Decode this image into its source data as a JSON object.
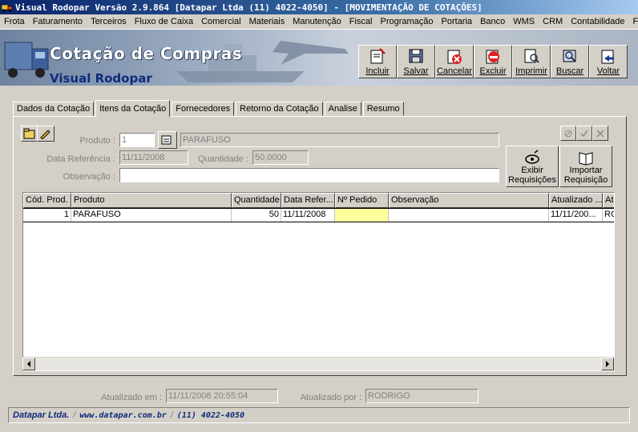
{
  "window": {
    "title": "Visual Rodopar Versão 2.9.864 [Datapar Ltda (11) 4022-4050]  - [MOVIMENTAÇÃO DE COTAÇÕES]"
  },
  "menu": [
    "Frota",
    "Faturamento",
    "Terceiros",
    "Fluxo de Caixa",
    "Comercial",
    "Materiais",
    "Manutenção",
    "Fiscal",
    "Programação",
    "Portaria",
    "Banco",
    "WMS",
    "CRM",
    "Contabilidade",
    "F"
  ],
  "banner": {
    "title": "Cotação de Compras",
    "subtitle": "Visual Rodopar"
  },
  "toolbar": {
    "incluir": "Incluir",
    "salvar": "Salvar",
    "cancelar": "Cancelar",
    "excluir": "Excluir",
    "imprimir": "Imprimir",
    "buscar": "Buscar",
    "voltar": "Voltar"
  },
  "tabs": [
    "Dados da Cotação",
    "Itens da Cotação",
    "Fornecedores",
    "Retorno da Cotação",
    "Analise",
    "Resumo"
  ],
  "active_tab": "Itens da Cotação",
  "form": {
    "produto_label": "Produto :",
    "produto_code": "1",
    "produto_desc": "PARAFUSO",
    "data_ref_label": "Data Referência :",
    "data_ref_value": "11/11/2008",
    "quantidade_label": "Quantidade :",
    "quantidade_value": "50,0000",
    "observacao_label": "Observação :",
    "observacao_value": ""
  },
  "actions": {
    "exibir_line1": "Exibir",
    "exibir_line2": "Requisições",
    "importar_line1": "Importar",
    "importar_line2": "Requisição"
  },
  "grid": {
    "columns": [
      "Cód. Prod.",
      "Produto",
      "Quantidade",
      "Data Refer...",
      "Nº Pedido",
      "Observação",
      "Atualizado ...",
      "Atu"
    ],
    "rows": [
      [
        "1",
        "PARAFUSO",
        "50",
        "11/11/2008",
        "",
        "",
        "11/11/200...",
        "RO"
      ]
    ]
  },
  "status": {
    "atualizado_em_label": "Atualizado em :",
    "atualizado_em_value": "11/11/2008 20:55:04",
    "atualizado_por_label": "Atualizado por :",
    "atualizado_por_value": "RODRIGO"
  },
  "footer": {
    "company": "Datapar Ltda.",
    "site": "www.datapar.com.br",
    "phone": "(11) 4022-4050"
  }
}
